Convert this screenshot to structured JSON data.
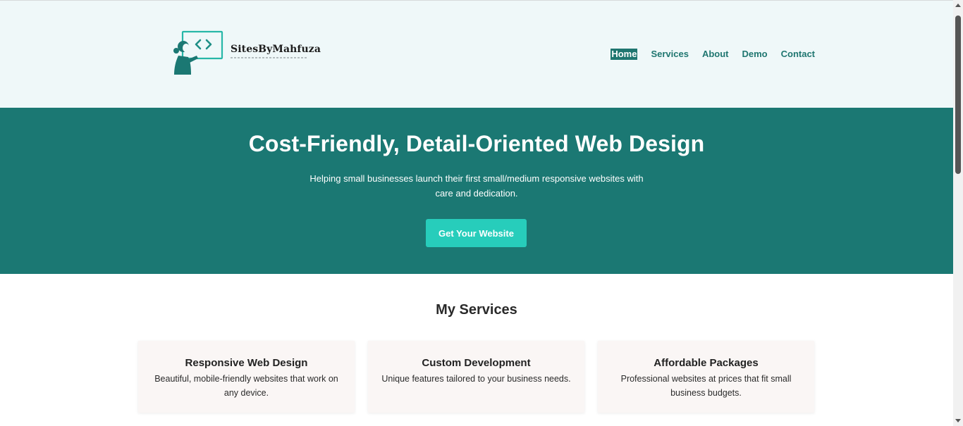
{
  "header": {
    "logo_text": "SitesByMahfuza",
    "nav": [
      {
        "label": "Home",
        "active": true
      },
      {
        "label": "Services",
        "active": false
      },
      {
        "label": "About",
        "active": false
      },
      {
        "label": "Demo",
        "active": false
      },
      {
        "label": "Contact",
        "active": false
      }
    ]
  },
  "hero": {
    "title": "Cost-Friendly, Detail-Oriented Web Design",
    "subtitle": "Helping small businesses launch their first small/medium responsive websites with care and dedication.",
    "cta_label": "Get Your Website"
  },
  "services": {
    "title": "My Services",
    "cards": [
      {
        "title": "Responsive Web Design",
        "description": "Beautiful, mobile-friendly websites that work on any device."
      },
      {
        "title": "Custom Development",
        "description": "Unique features tailored to your business needs."
      },
      {
        "title": "Affordable Packages",
        "description": "Professional websites at prices that fit small business budgets."
      }
    ]
  },
  "colors": {
    "header_bg": "#eff8f9",
    "brand_teal": "#1b7873",
    "cta_accent": "#27cdbb",
    "card_bg": "#faf6f5"
  },
  "icons": {
    "logo": "developer-with-code-screen-icon"
  }
}
